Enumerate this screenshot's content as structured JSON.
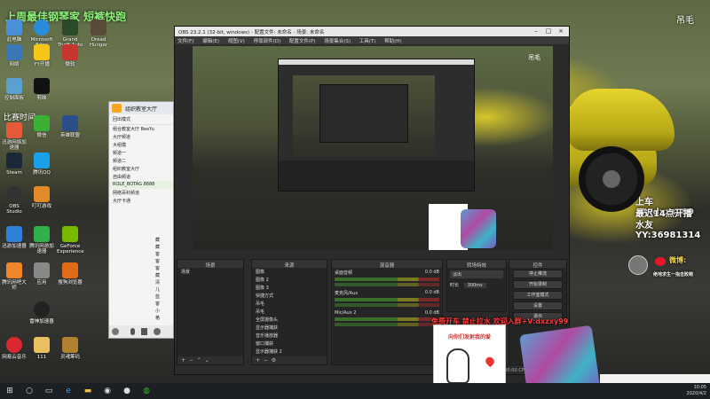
{
  "desktop": {
    "icons_col1": [
      "此电脑",
      "网络",
      "控制面板",
      "回收站",
      "迅游网络加速器",
      "Steam",
      "OBS Studio",
      "迅游加速器",
      "腾讯网吧大师",
      "网易云音乐"
    ],
    "icons_col2": [
      "Microsoft Edge",
      "YY开播",
      "剪映",
      "微信",
      "腾讯QQ",
      "叮叮游戏",
      "腾讯网游加速器",
      "应用",
      "雷神加速器",
      "111"
    ],
    "icons_col3": [
      "Grand Theft Auto V",
      "Dread Hunger",
      "微软",
      "",
      "英雄联盟",
      "",
      "",
      "GeForce Experience",
      "搜狗浏览器",
      "灵魂筹码"
    ],
    "top_left_banner": "上周最佳钢琴家 短裤快跑",
    "top_left_sub": "比赛时间",
    "top_right_label": "吊毛"
  },
  "obs": {
    "title": "OBS 23.2.1 (32-bit, windows) - 配置文件: 未命名 - 场景: 未命名",
    "menu": [
      "文件(F)",
      "编辑(E)",
      "视图(V)",
      "停靠部件(D)",
      "配置文件(P)",
      "场景集合(S)",
      "工具(T)",
      "帮助(H)"
    ],
    "preview_label": "吊毛",
    "scenes_title": "场景",
    "scenes": [
      "场景"
    ],
    "sources_title": "来源",
    "sources": [
      "图像",
      "图像 2",
      "图像 3",
      "快捷方式",
      "吊毛",
      "吊毛",
      "全屏摄像头",
      "显示器捕获",
      "音乐播放器",
      "窗口捕获",
      "显示器捕获 2"
    ],
    "mixer_title": "混音器",
    "mixer": [
      {
        "name": "桌面音频",
        "db": "0.0 dB"
      },
      {
        "name": "麦克风/Aux",
        "db": "0.0 dB"
      },
      {
        "name": "Mic/Aux 2",
        "db": "0.0 dB"
      }
    ],
    "transitions_title": "转场特效",
    "transition_type": "淡出",
    "duration_label": "时长",
    "duration": "300ms",
    "controls_title": "控件",
    "controls": [
      "停止推流",
      "开始录制",
      "工作室模式",
      "设置",
      "退出"
    ],
    "status": "LIVE: 00:00:00  REC: 00:00:00  CPU: 8.2%, 30.00 fps"
  },
  "chat": {
    "title": "组织教室大厅",
    "subtitle": "回出模式",
    "rows": [
      "组合教室大厅 BeeYu",
      "大厅频道",
      "大组模",
      "频道一",
      "频道二",
      "组织教室大厅",
      "自由频道",
      "ROLE_BOTAG 8888",
      "网络百科频道",
      "大厅卡通"
    ],
    "side_chars": [
      "藏",
      "藏",
      "客",
      "客",
      "客",
      "藏",
      "清",
      "儿",
      "蓝",
      "客",
      "小",
      "格"
    ]
  },
  "overlays": {
    "right_line1": "上车+V:dxzxy99",
    "right_line2": "最迟14点开播",
    "right_line3": "水友YY:36981314",
    "weibo_label": "微博:",
    "weibo_name": "绝地求生一指击败萌",
    "bottom_red_text": "免费开车 禁止拉水 欢迎入群+V:dxzxy99",
    "meme_caption": "向你们发射我的爱"
  },
  "taskbar": {
    "time": "10:05",
    "date": "2020/4/2"
  }
}
